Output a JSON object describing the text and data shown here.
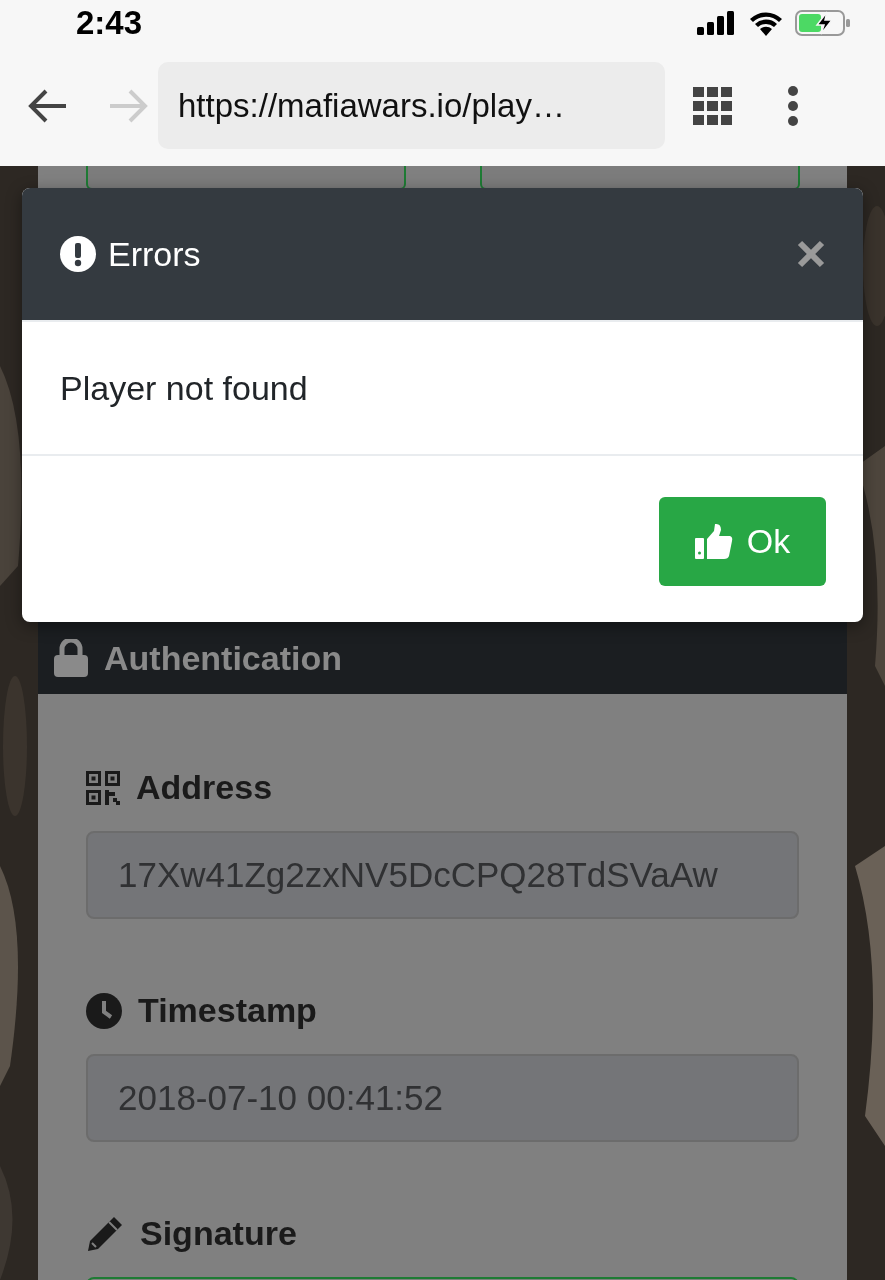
{
  "status_bar": {
    "time": "2:43"
  },
  "browser": {
    "url": "https://mafiawars.io/play…"
  },
  "modal": {
    "title": "Errors",
    "message": "Player not found",
    "buttons": [
      {
        "label": "Ok"
      }
    ]
  },
  "panel": {
    "title": "Authentication",
    "fields": [
      {
        "kind": "address",
        "label": "Address",
        "value": "17Xw41Zg2zxNV5DcCPQ28TdSVaAw"
      },
      {
        "kind": "timestamp",
        "label": "Timestamp",
        "value": "2018-07-10 00:41:52"
      },
      {
        "kind": "signature",
        "label": "Signature"
      }
    ]
  }
}
